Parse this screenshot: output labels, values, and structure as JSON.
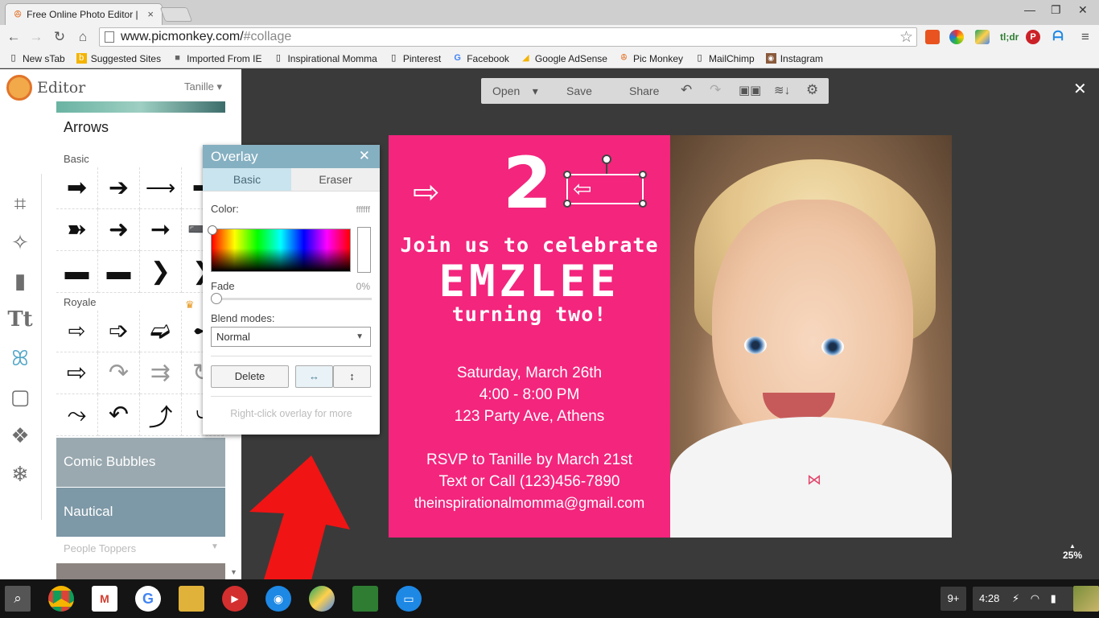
{
  "browser": {
    "tab_title": "Free Online Photo Editor |",
    "url_host": "www.picmonkey.com/",
    "url_path": "#collage",
    "bookmarks": [
      "New sTab",
      "Suggested Sites",
      "Imported From IE",
      "Inspirational Momma",
      "Pinterest",
      "Facebook",
      "Google AdSense",
      "Pic Monkey",
      "MailChimp",
      "Instagram"
    ]
  },
  "app": {
    "brand": "Editor",
    "user": "Tanille",
    "library_title": "Arrows",
    "section_basic": "Basic",
    "section_royale": "Royale",
    "banner_comic": "Comic Bubbles",
    "banner_nautical": "Nautical",
    "people_toppers": "People Toppers",
    "toolbar": {
      "open": "Open",
      "save": "Save",
      "share": "Share"
    },
    "zoom": "25%"
  },
  "overlay": {
    "title": "Overlay",
    "tab_basic": "Basic",
    "tab_eraser": "Eraser",
    "color_label": "Color:",
    "color_value": "ffffff",
    "fade_label": "Fade",
    "fade_value": "0%",
    "fade_level": 0,
    "blend_label": "Blend modes:",
    "blend_value": "Normal",
    "delete_label": "Delete",
    "hint": "Right-click overlay for more"
  },
  "card": {
    "number": "2",
    "line1": "Join us to celebrate",
    "name": "EMZLEE",
    "line2": "turning two!",
    "details": [
      "Saturday, March 26th",
      "4:00 - 8:00 PM",
      "123 Party Ave, Athens"
    ],
    "rsvp": [
      "RSVP to Tanille by March 21st",
      "Text or Call (123)456-7890",
      "theinspirationalmomma@gmail.com"
    ]
  },
  "shelf": {
    "notif": "9+",
    "clock": "4:28"
  },
  "colors": {
    "card_pink": "#f3257d",
    "overlay_header": "#85b0c1",
    "accent_blue": "#51a6c7"
  }
}
